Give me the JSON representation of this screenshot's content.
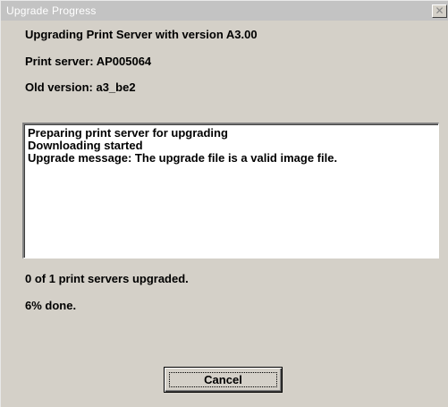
{
  "window": {
    "title": "Upgrade Progress",
    "close_glyph": "✕"
  },
  "info": {
    "heading": "Upgrading Print Server with version A3.00",
    "print_server": "Print server: AP005064",
    "old_version": "Old version: a3_be2"
  },
  "log": {
    "lines": [
      "Preparing print server for upgrading",
      "Downloading started",
      "Upgrade message: The upgrade file is a valid image file."
    ]
  },
  "status": {
    "servers_upgraded": "0 of 1 print servers upgraded.",
    "percent_done": "6% done.",
    "progress": 0.06
  },
  "buttons": {
    "cancel_label": "Cancel"
  },
  "colors": {
    "dialog_face": "#d4d0c8",
    "titlebar_inactive": "#c3c3c3",
    "title_text": "#ffffff",
    "log_background": "#ffffff"
  }
}
